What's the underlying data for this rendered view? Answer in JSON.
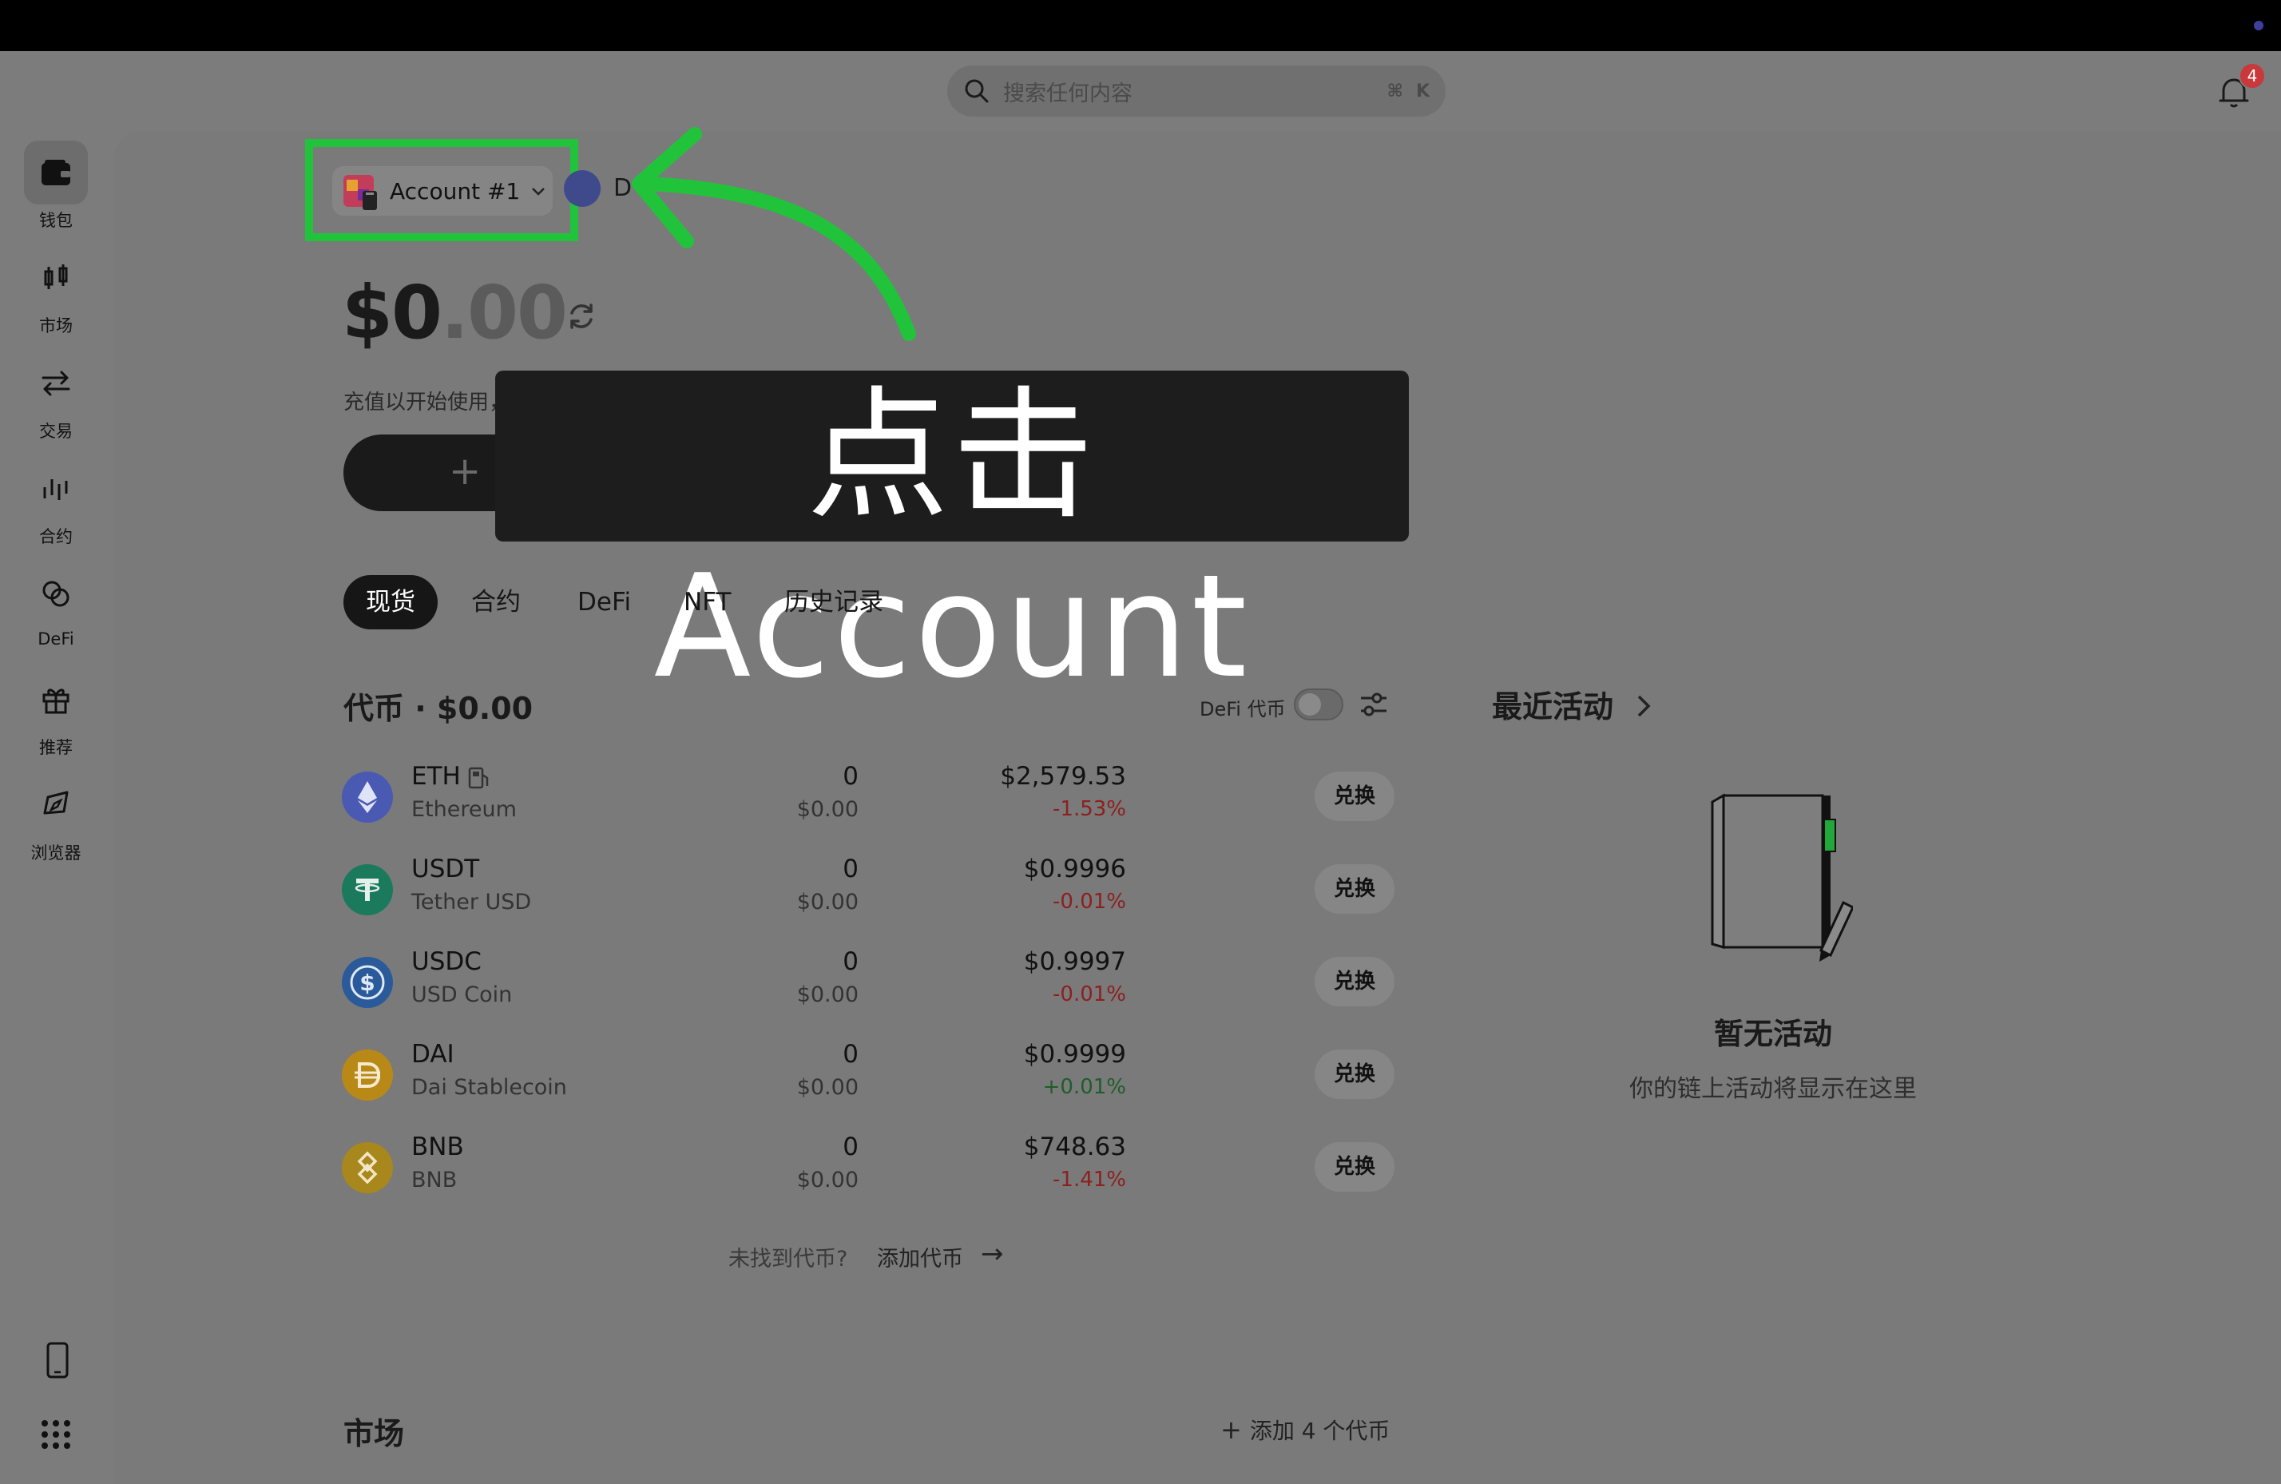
{
  "search": {
    "placeholder": "搜索任何内容",
    "shortcut_symbol": "⌘",
    "shortcut_key": "K"
  },
  "notifications": {
    "count": "4"
  },
  "sidebar": {
    "items": [
      {
        "label": "钱包",
        "icon": "wallet-icon",
        "active": true
      },
      {
        "label": "市场",
        "icon": "candlestick-icon"
      },
      {
        "label": "交易",
        "icon": "swap-arrows-icon"
      },
      {
        "label": "合约",
        "icon": "bars-icon"
      },
      {
        "label": "DeFi",
        "icon": "defi-circles-icon"
      },
      {
        "label": "推荐",
        "icon": "gift-icon"
      },
      {
        "label": "浏览器",
        "icon": "compass-icon"
      }
    ],
    "bottom_icons": [
      "phone-icon",
      "apps-grid-icon"
    ]
  },
  "account": {
    "name": "Account #1",
    "chain_letter": "D"
  },
  "balance": {
    "whole": "$0",
    "decimals": ".00"
  },
  "subtitle": "充值以开始使用，可随时取回。",
  "caption": "点击 Account",
  "tabs": [
    {
      "label": "现货",
      "active": true
    },
    {
      "label": "合约"
    },
    {
      "label": "DeFi"
    },
    {
      "label": "NFT"
    },
    {
      "label": "历史记录"
    }
  ],
  "tokens": {
    "title": "代币 · $0.00",
    "defi_toggle_label": "DeFi 代币",
    "swap_label": "兑换",
    "rows": [
      {
        "symbol": "ETH",
        "name": "Ethereum",
        "amount": "0",
        "value": "$0.00",
        "price": "$2,579.53",
        "change": "-1.53%",
        "color": "#4a5ab3"
      },
      {
        "symbol": "USDT",
        "name": "Tether USD",
        "amount": "0",
        "value": "$0.00",
        "price": "$0.9996",
        "change": "-0.01%",
        "color": "#1b7a5c"
      },
      {
        "symbol": "USDC",
        "name": "USD Coin",
        "amount": "0",
        "value": "$0.00",
        "price": "$0.9997",
        "change": "-0.01%",
        "color": "#2a5a9a"
      },
      {
        "symbol": "DAI",
        "name": "Dai Stablecoin",
        "amount": "0",
        "value": "$0.00",
        "price": "$0.9999",
        "change": "+0.01%",
        "color": "#b98918"
      },
      {
        "symbol": "BNB",
        "name": "BNB",
        "amount": "0",
        "value": "$0.00",
        "price": "$748.63",
        "change": "-1.41%",
        "color": "#a8871c"
      }
    ],
    "not_found": "未找到代币?",
    "add_token": "添加代币"
  },
  "market": {
    "title": "市场",
    "add_label": "添加 4 个代币"
  },
  "recent": {
    "title": "最近活动",
    "empty_title": "暂无活动",
    "empty_sub": "你的链上活动将显示在这里"
  },
  "colors": {
    "highlight": "#21c33b",
    "negative": "#8c2020",
    "positive": "#1e5e2a"
  }
}
